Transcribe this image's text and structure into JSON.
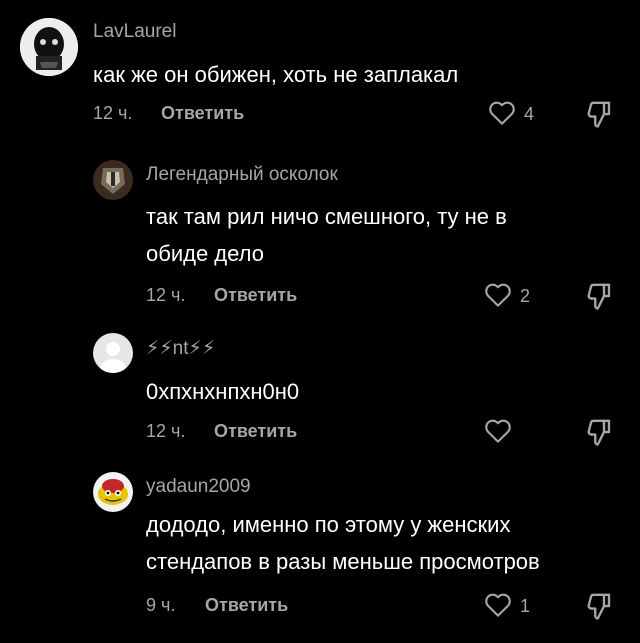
{
  "comments": [
    {
      "username": "LavLaurel",
      "text_lines": [
        "как же он обижен, хоть не заплакал"
      ],
      "time": "12 ч.",
      "reply_label": "Ответить",
      "likes": "4"
    },
    {
      "username": "Легендарный осколок",
      "text_lines": [
        "так там рил ничо смешного, ту не в",
        "обиде дело"
      ],
      "time": "12 ч.",
      "reply_label": "Ответить",
      "likes": "2"
    },
    {
      "username": "⚡⚡nt⚡⚡",
      "text_lines": [
        "0хпхнхнпхн0н0"
      ],
      "time": "12 ч.",
      "reply_label": "Ответить",
      "likes": ""
    },
    {
      "username": "yadaun2009",
      "text_lines": [
        "дододо, именно по этому у женских",
        "стендапов в разы меньше просмотров"
      ],
      "time": "9 ч.",
      "reply_label": "Ответить",
      "likes": "1"
    }
  ],
  "colors": {
    "background": "#000000",
    "text": "#ffffff",
    "muted": "#a6a6a6",
    "username_reply": "#a0a0a0"
  },
  "icons": {
    "like": "heart-outline-icon",
    "dislike": "thumbs-down-outline-icon"
  }
}
